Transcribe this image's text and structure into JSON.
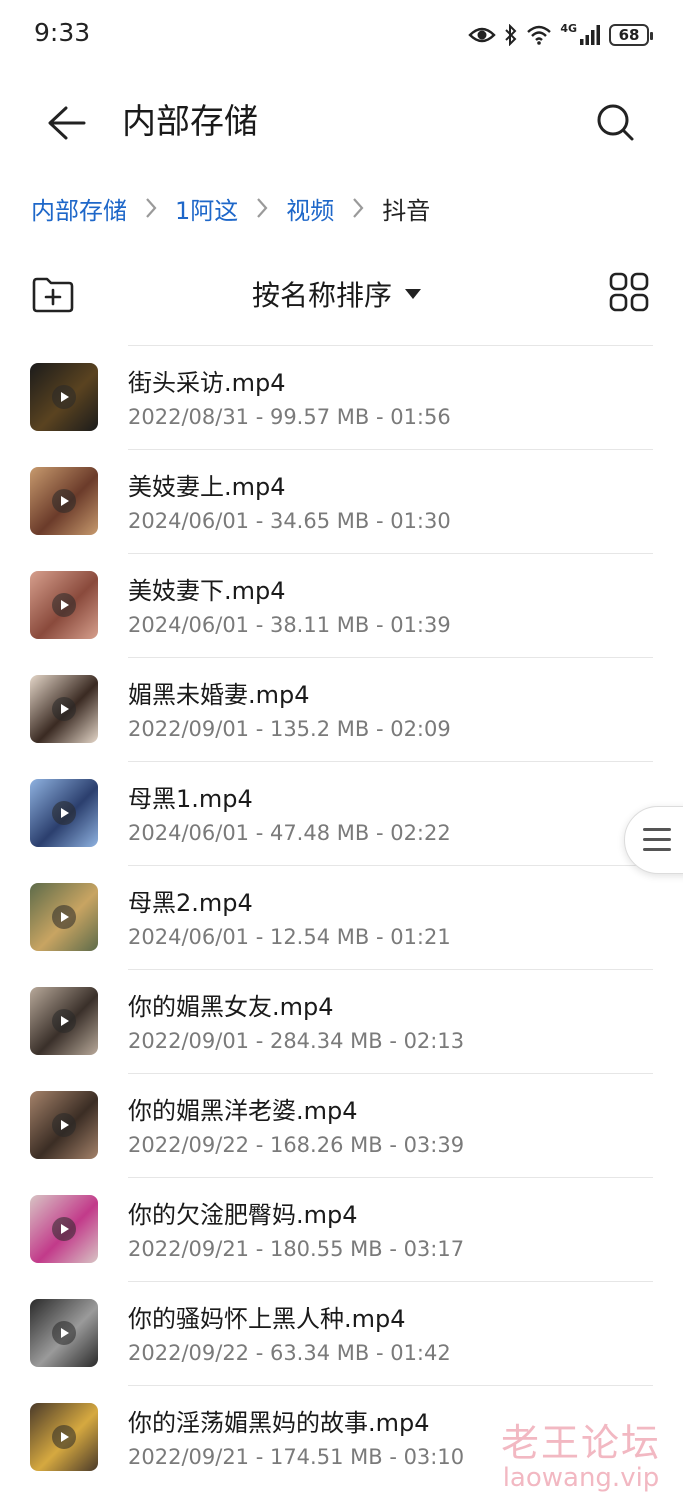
{
  "status_bar": {
    "time": "9:33",
    "network_label": "4G",
    "battery": "68",
    "icons": [
      "eye-icon",
      "bluetooth-icon",
      "wifi-icon",
      "signal-icon",
      "battery-icon"
    ]
  },
  "header": {
    "title": "内部存储",
    "back_icon": "arrow-left-icon",
    "search_icon": "search-icon"
  },
  "breadcrumb": {
    "items": [
      {
        "label": "内部存储"
      },
      {
        "label": "1阿这"
      },
      {
        "label": "视频"
      },
      {
        "label": "抖音"
      }
    ]
  },
  "toolbar": {
    "sort_label": "按名称排序",
    "new_folder_icon": "folder-plus-icon",
    "view_icon": "grid-view-icon",
    "sort_icon": "caret-down-icon"
  },
  "files": [
    {
      "name": "街头采访.mp4",
      "meta": "2022/08/31 - 99.57 MB - 01:56",
      "thumb_colors": [
        "#1b1b1b",
        "#5a4320"
      ]
    },
    {
      "name": "美妓妻上.mp4",
      "meta": "2024/06/01 - 34.65 MB - 01:30",
      "thumb_colors": [
        "#c79a6e",
        "#6b3b2a"
      ]
    },
    {
      "name": "美妓妻下.mp4",
      "meta": "2024/06/01 - 38.11 MB - 01:39",
      "thumb_colors": [
        "#d69f8d",
        "#8a4a3c"
      ]
    },
    {
      "name": "媚黑未婚妻.mp4",
      "meta": "2022/09/01 - 135.2 MB - 02:09",
      "thumb_colors": [
        "#e4d6c8",
        "#3a2a22"
      ]
    },
    {
      "name": "母黑1.mp4",
      "meta": "2024/06/01 - 47.48 MB - 02:22",
      "thumb_colors": [
        "#8fb2e0",
        "#2b3f6e"
      ]
    },
    {
      "name": "母黑2.mp4",
      "meta": "2024/06/01 - 12.54 MB - 01:21",
      "thumb_colors": [
        "#5d6b4a",
        "#c8a462"
      ]
    },
    {
      "name": "你的媚黑女友.mp4",
      "meta": "2022/09/01 - 284.34 MB - 02:13",
      "thumb_colors": [
        "#b8a99a",
        "#3a302a"
      ]
    },
    {
      "name": "你的媚黑洋老婆.mp4",
      "meta": "2022/09/22 - 168.26 MB - 03:39",
      "thumb_colors": [
        "#a4826a",
        "#3b2d24"
      ]
    },
    {
      "name": "你的欠淦肥臀妈.mp4",
      "meta": "2022/09/21 - 180.55 MB - 03:17",
      "thumb_colors": [
        "#d8c4c4",
        "#c23a8a"
      ]
    },
    {
      "name": "你的骚妈怀上黑人种.mp4",
      "meta": "2022/09/22 - 63.34 MB - 01:42",
      "thumb_colors": [
        "#2a2a2a",
        "#9a9a9a"
      ]
    },
    {
      "name": "你的淫荡媚黑妈的故事.mp4",
      "meta": "2022/09/21 - 174.51 MB - 03:10",
      "thumb_colors": [
        "#4a3a2a",
        "#d6a940"
      ]
    }
  ],
  "side_handle_icon": "menu-lines-icon",
  "watermark": {
    "cn": "老王论坛",
    "en": "laowang.vip"
  }
}
